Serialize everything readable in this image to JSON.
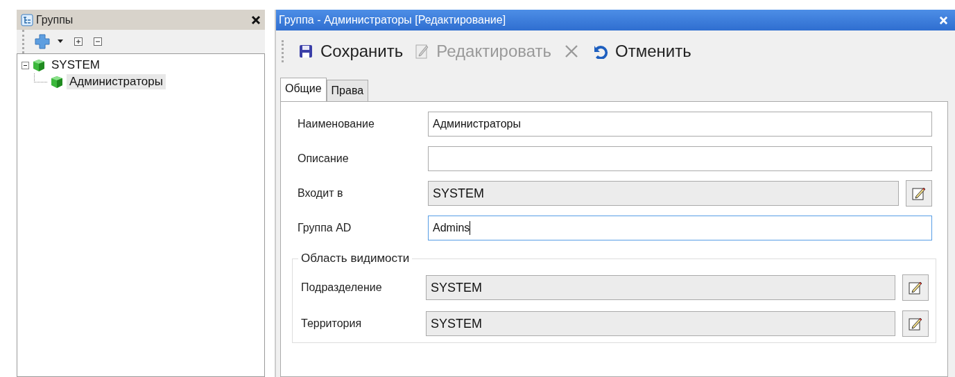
{
  "groups_panel": {
    "title": "Группы",
    "tree": [
      {
        "label": "SYSTEM",
        "expanded": true,
        "selected": false,
        "children": [
          {
            "label": "Администраторы",
            "selected": true
          }
        ]
      }
    ]
  },
  "editor": {
    "title": "Группа - Администраторы [Редактирование]",
    "toolbar": [
      {
        "kind": "save",
        "label": "Сохранить",
        "disabled": false
      },
      {
        "kind": "edit",
        "label": "Редактировать",
        "disabled": true
      },
      {
        "kind": "delete",
        "disabled": true
      },
      {
        "kind": "cancel",
        "label": "Отменить",
        "disabled": false
      }
    ],
    "tabs": [
      {
        "label": "Общие",
        "selected": true
      },
      {
        "label": "Права",
        "selected": false
      }
    ],
    "fields": [
      {
        "label": "Наименование",
        "value": "Администраторы",
        "readonly": false,
        "picker": false,
        "focused": false
      },
      {
        "label": "Описание",
        "readonly": false,
        "picker": false,
        "focused": false
      },
      {
        "label": "Входит в",
        "value": "SYSTEM",
        "readonly": true,
        "picker": true,
        "focused": false
      },
      {
        "label": "Группа AD",
        "value": "Admins",
        "readonly": false,
        "picker": false,
        "focused": true
      }
    ],
    "visibility": {
      "title": "Область видимости",
      "fields": [
        {
          "label": "Подразделение",
          "value": "SYSTEM",
          "readonly": true,
          "picker": true,
          "focused": false
        },
        {
          "label": "Территория",
          "value": "SYSTEM",
          "readonly": true,
          "picker": true,
          "focused": false
        }
      ]
    }
  }
}
